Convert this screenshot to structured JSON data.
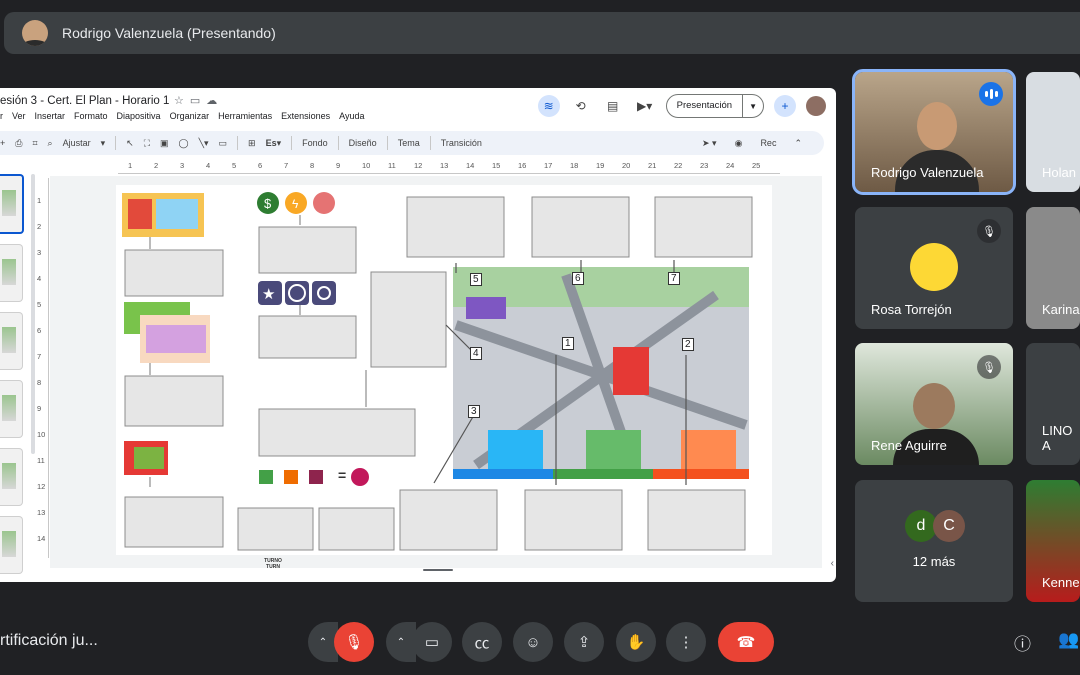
{
  "presenter_bar": {
    "label": "Rodrigo Valenzuela (Presentando)"
  },
  "slides": {
    "doc_title": "esión 3 - Cert. El Plan - Horario 1",
    "menu": [
      "r",
      "Ver",
      "Insertar",
      "Formato",
      "Diapositiva",
      "Organizar",
      "Herramientas",
      "Extensiones",
      "Ayuda"
    ],
    "present_label": "Presentación",
    "toolbar": {
      "zoom": "Ajustar",
      "fondo": "Fondo",
      "diseno": "Diseño",
      "tema": "Tema",
      "transicion": "Transición",
      "rec": "Rec"
    },
    "ruler_top": [
      "1",
      "2",
      "3",
      "4",
      "5",
      "6",
      "7",
      "8",
      "9",
      "10",
      "11",
      "12",
      "13",
      "14",
      "15",
      "16",
      "17",
      "18",
      "19",
      "20",
      "21",
      "22",
      "23",
      "24",
      "25"
    ],
    "ruler_left": [
      "1",
      "2",
      "3",
      "4",
      "5",
      "6",
      "7",
      "8",
      "9",
      "10",
      "11",
      "12",
      "13",
      "14"
    ],
    "slide_content": {
      "turn_token": "TURNO TURN",
      "equals": "=",
      "map_numbers": [
        "5",
        "6",
        "7",
        "4",
        "1",
        "2",
        "3"
      ]
    }
  },
  "participants": [
    {
      "name": "Rodrigo Valenzuela",
      "status": "speaking"
    },
    {
      "name": "Holan",
      "status": ""
    },
    {
      "name": "Rosa Torrejón",
      "status": "muted"
    },
    {
      "name": "Karina",
      "status": ""
    },
    {
      "name": "Rene Aguirre",
      "status": "muted"
    },
    {
      "name": "LINO A",
      "status": ""
    },
    {
      "name": "12 más",
      "initials": [
        "d",
        "C"
      ]
    },
    {
      "name": "Kenne",
      "status": ""
    }
  ],
  "bottom": {
    "meeting_name": "rtificación ju..."
  },
  "colors": {
    "bg": "#202124",
    "tile": "#3c4043",
    "red": "#ea4335",
    "accent": "#8ab4f8"
  }
}
